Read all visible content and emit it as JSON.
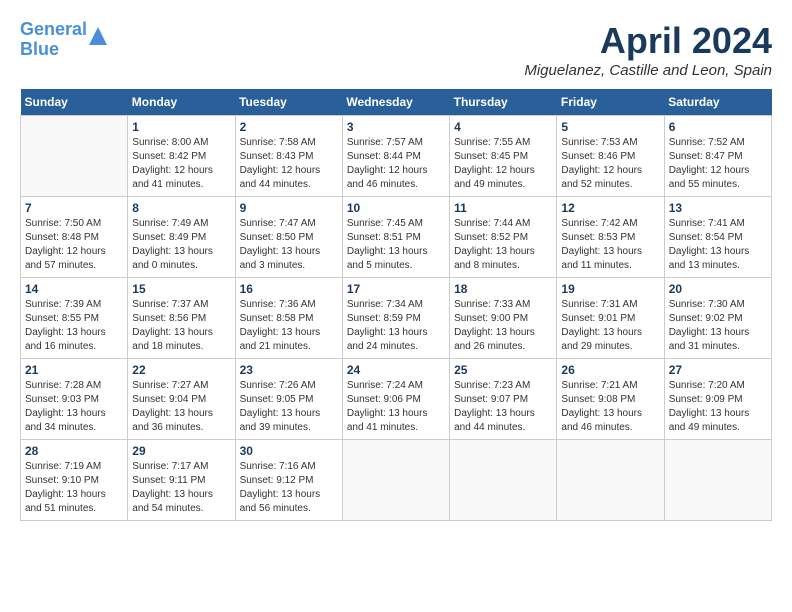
{
  "header": {
    "logo_line1": "General",
    "logo_line2": "Blue",
    "month_title": "April 2024",
    "location": "Miguelanez, Castille and Leon, Spain"
  },
  "days_of_week": [
    "Sunday",
    "Monday",
    "Tuesday",
    "Wednesday",
    "Thursday",
    "Friday",
    "Saturday"
  ],
  "weeks": [
    [
      {
        "day": "",
        "info": ""
      },
      {
        "day": "1",
        "info": "Sunrise: 8:00 AM\nSunset: 8:42 PM\nDaylight: 12 hours\nand 41 minutes."
      },
      {
        "day": "2",
        "info": "Sunrise: 7:58 AM\nSunset: 8:43 PM\nDaylight: 12 hours\nand 44 minutes."
      },
      {
        "day": "3",
        "info": "Sunrise: 7:57 AM\nSunset: 8:44 PM\nDaylight: 12 hours\nand 46 minutes."
      },
      {
        "day": "4",
        "info": "Sunrise: 7:55 AM\nSunset: 8:45 PM\nDaylight: 12 hours\nand 49 minutes."
      },
      {
        "day": "5",
        "info": "Sunrise: 7:53 AM\nSunset: 8:46 PM\nDaylight: 12 hours\nand 52 minutes."
      },
      {
        "day": "6",
        "info": "Sunrise: 7:52 AM\nSunset: 8:47 PM\nDaylight: 12 hours\nand 55 minutes."
      }
    ],
    [
      {
        "day": "7",
        "info": "Sunrise: 7:50 AM\nSunset: 8:48 PM\nDaylight: 12 hours\nand 57 minutes."
      },
      {
        "day": "8",
        "info": "Sunrise: 7:49 AM\nSunset: 8:49 PM\nDaylight: 13 hours\nand 0 minutes."
      },
      {
        "day": "9",
        "info": "Sunrise: 7:47 AM\nSunset: 8:50 PM\nDaylight: 13 hours\nand 3 minutes."
      },
      {
        "day": "10",
        "info": "Sunrise: 7:45 AM\nSunset: 8:51 PM\nDaylight: 13 hours\nand 5 minutes."
      },
      {
        "day": "11",
        "info": "Sunrise: 7:44 AM\nSunset: 8:52 PM\nDaylight: 13 hours\nand 8 minutes."
      },
      {
        "day": "12",
        "info": "Sunrise: 7:42 AM\nSunset: 8:53 PM\nDaylight: 13 hours\nand 11 minutes."
      },
      {
        "day": "13",
        "info": "Sunrise: 7:41 AM\nSunset: 8:54 PM\nDaylight: 13 hours\nand 13 minutes."
      }
    ],
    [
      {
        "day": "14",
        "info": "Sunrise: 7:39 AM\nSunset: 8:55 PM\nDaylight: 13 hours\nand 16 minutes."
      },
      {
        "day": "15",
        "info": "Sunrise: 7:37 AM\nSunset: 8:56 PM\nDaylight: 13 hours\nand 18 minutes."
      },
      {
        "day": "16",
        "info": "Sunrise: 7:36 AM\nSunset: 8:58 PM\nDaylight: 13 hours\nand 21 minutes."
      },
      {
        "day": "17",
        "info": "Sunrise: 7:34 AM\nSunset: 8:59 PM\nDaylight: 13 hours\nand 24 minutes."
      },
      {
        "day": "18",
        "info": "Sunrise: 7:33 AM\nSunset: 9:00 PM\nDaylight: 13 hours\nand 26 minutes."
      },
      {
        "day": "19",
        "info": "Sunrise: 7:31 AM\nSunset: 9:01 PM\nDaylight: 13 hours\nand 29 minutes."
      },
      {
        "day": "20",
        "info": "Sunrise: 7:30 AM\nSunset: 9:02 PM\nDaylight: 13 hours\nand 31 minutes."
      }
    ],
    [
      {
        "day": "21",
        "info": "Sunrise: 7:28 AM\nSunset: 9:03 PM\nDaylight: 13 hours\nand 34 minutes."
      },
      {
        "day": "22",
        "info": "Sunrise: 7:27 AM\nSunset: 9:04 PM\nDaylight: 13 hours\nand 36 minutes."
      },
      {
        "day": "23",
        "info": "Sunrise: 7:26 AM\nSunset: 9:05 PM\nDaylight: 13 hours\nand 39 minutes."
      },
      {
        "day": "24",
        "info": "Sunrise: 7:24 AM\nSunset: 9:06 PM\nDaylight: 13 hours\nand 41 minutes."
      },
      {
        "day": "25",
        "info": "Sunrise: 7:23 AM\nSunset: 9:07 PM\nDaylight: 13 hours\nand 44 minutes."
      },
      {
        "day": "26",
        "info": "Sunrise: 7:21 AM\nSunset: 9:08 PM\nDaylight: 13 hours\nand 46 minutes."
      },
      {
        "day": "27",
        "info": "Sunrise: 7:20 AM\nSunset: 9:09 PM\nDaylight: 13 hours\nand 49 minutes."
      }
    ],
    [
      {
        "day": "28",
        "info": "Sunrise: 7:19 AM\nSunset: 9:10 PM\nDaylight: 13 hours\nand 51 minutes."
      },
      {
        "day": "29",
        "info": "Sunrise: 7:17 AM\nSunset: 9:11 PM\nDaylight: 13 hours\nand 54 minutes."
      },
      {
        "day": "30",
        "info": "Sunrise: 7:16 AM\nSunset: 9:12 PM\nDaylight: 13 hours\nand 56 minutes."
      },
      {
        "day": "",
        "info": ""
      },
      {
        "day": "",
        "info": ""
      },
      {
        "day": "",
        "info": ""
      },
      {
        "day": "",
        "info": ""
      }
    ]
  ]
}
